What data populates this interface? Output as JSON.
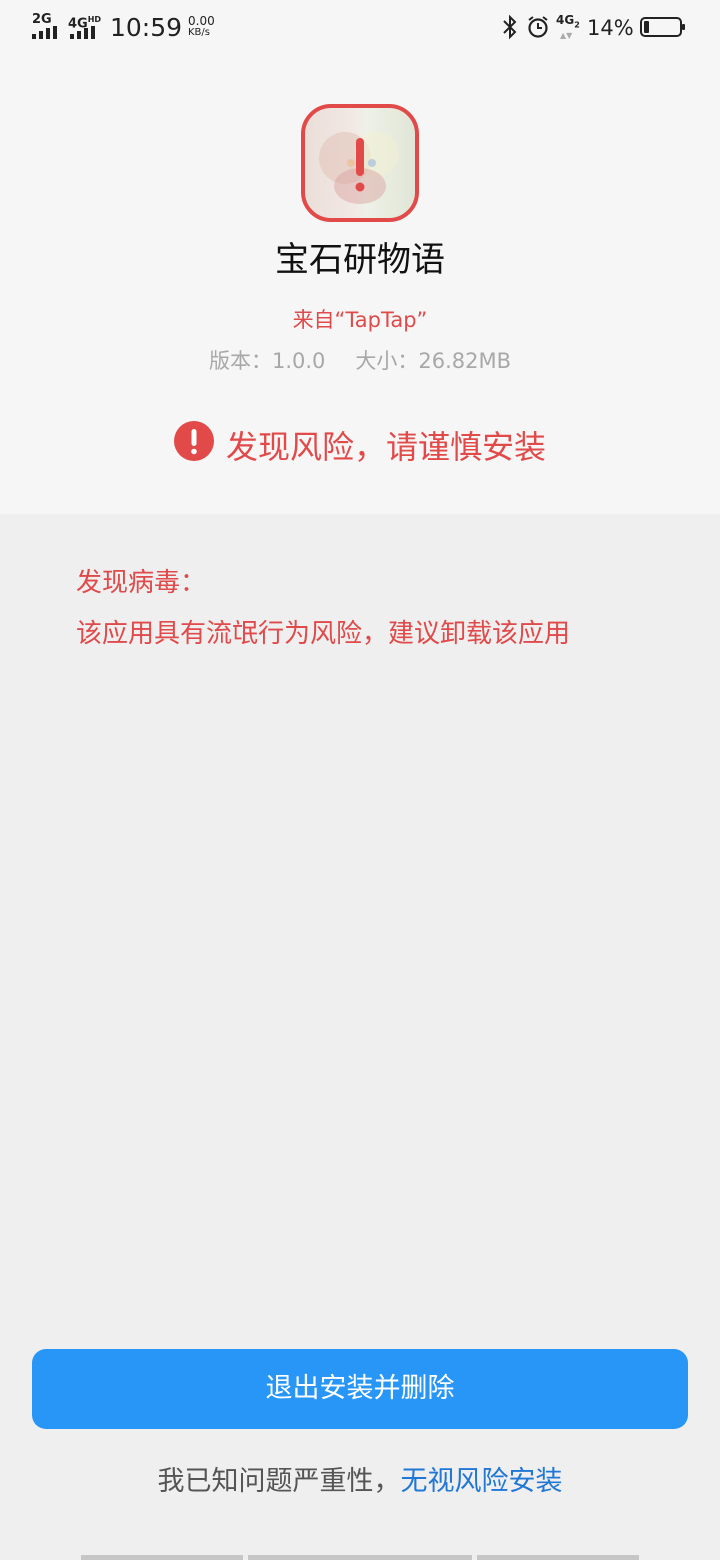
{
  "status_bar": {
    "network1": "2G",
    "network2": "4G",
    "network2_sup": "HD",
    "time": "10:59",
    "speed_value": "0.00",
    "speed_unit": "KB/s",
    "sim2_network": "4G",
    "sim2_index": "2",
    "battery_percent": "14%",
    "battery_level": 0.14
  },
  "app": {
    "icon_name": "app-icon-warning",
    "name": "宝石研物语",
    "source": "来自“TapTap”",
    "version_label": "版本：",
    "version": "1.0.0",
    "size_label": "大小：",
    "size": "26.82MB"
  },
  "warning": {
    "icon": "exclamation-circle-icon",
    "text": "发现风险，请谨慎安装",
    "color": "#e24a4a"
  },
  "virus": {
    "title": "发现病毒：",
    "description": "该应用具有流氓行为风险，建议卸载该应用"
  },
  "actions": {
    "primary_button": "退出安装并删除",
    "ignore_text": "我已知问题严重性，",
    "ignore_link": "无视风险安装",
    "primary_color": "#2896f6",
    "link_color": "#2077d5"
  }
}
